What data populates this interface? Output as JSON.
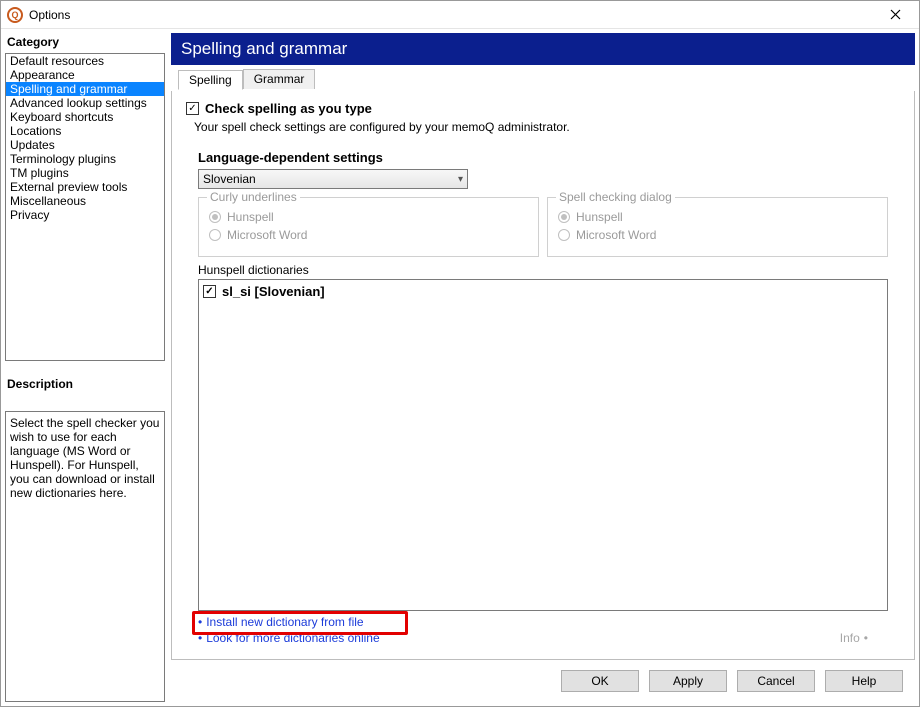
{
  "window": {
    "title": "Options"
  },
  "sidebar": {
    "category_label": "Category",
    "items": [
      "Default resources",
      "Appearance",
      "Spelling and grammar",
      "Advanced lookup settings",
      "Keyboard shortcuts",
      "Locations",
      "Updates",
      "Terminology plugins",
      "TM plugins",
      "External preview tools",
      "Miscellaneous",
      "Privacy"
    ],
    "selected_index": 2,
    "description_label": "Description",
    "description_text": "Select the spell checker you wish to use for each language (MS Word or Hunspell). For Hunspell, you can download or install new dictionaries here."
  },
  "header": {
    "title": "Spelling and grammar"
  },
  "tabs": {
    "items": [
      "Spelling",
      "Grammar"
    ],
    "active": 0
  },
  "spelling": {
    "check_label": "Check spelling as you type",
    "check_checked": true,
    "admin_hint": "Your spell check settings are configured by your memoQ administrator.",
    "langdep_label": "Language-dependent settings",
    "language": "Slovenian",
    "curly_legend": "Curly underlines",
    "dialog_legend": "Spell checking dialog",
    "opt_hunspell": "Hunspell",
    "opt_word": "Microsoft Word",
    "hunspell_dict_label": "Hunspell dictionaries",
    "dict_item": "sl_si [Slovenian]",
    "link_install": "Install new dictionary from file",
    "link_lookup": "Look for more dictionaries online",
    "info_label": "Info"
  },
  "footer": {
    "ok": "OK",
    "apply": "Apply",
    "cancel": "Cancel",
    "help": "Help"
  }
}
